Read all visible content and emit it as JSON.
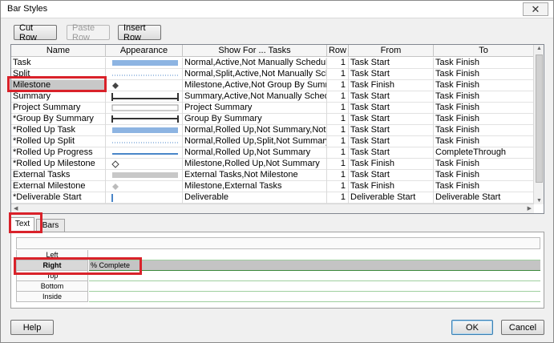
{
  "window": {
    "title": "Bar Styles",
    "close_glyph": "✕"
  },
  "toolbar": {
    "cut_row": "Cut Row",
    "paste_row": "Paste Row",
    "insert_row": "Insert Row"
  },
  "table": {
    "columns": [
      "Name",
      "Appearance",
      "Show For ... Tasks",
      "Row",
      "From",
      "To"
    ],
    "rows": [
      {
        "name": "Task",
        "appearance": "bar-blue",
        "show_for": "Normal,Active,Not Manually Scheduled",
        "row": "1",
        "from": "Task Start",
        "to": "Task Finish"
      },
      {
        "name": "Split",
        "appearance": "dotted-blue",
        "show_for": "Normal,Split,Active,Not Manually Schedu",
        "row": "1",
        "from": "Task Start",
        "to": "Task Finish"
      },
      {
        "name": "Milestone",
        "appearance": "diamond-dark",
        "show_for": "Milestone,Active,Not Group By Summary",
        "row": "1",
        "from": "Task Finish",
        "to": "Task Finish"
      },
      {
        "name": "Summary",
        "appearance": "summary-bracket",
        "show_for": "Summary,Active,Not Manually Scheduled",
        "row": "1",
        "from": "Task Start",
        "to": "Task Finish"
      },
      {
        "name": "Project Summary",
        "appearance": "project-summary",
        "show_for": "Project Summary",
        "row": "1",
        "from": "Task Start",
        "to": "Task Finish"
      },
      {
        "name": "*Group By Summary",
        "appearance": "group-bracket",
        "show_for": "Group By Summary",
        "row": "1",
        "from": "Task Start",
        "to": "Task Finish"
      },
      {
        "name": "*Rolled Up Task",
        "appearance": "bar-blue",
        "show_for": "Normal,Rolled Up,Not Summary,Not Ma",
        "row": "1",
        "from": "Task Start",
        "to": "Task Finish"
      },
      {
        "name": "*Rolled Up Split",
        "appearance": "dotted-blue",
        "show_for": "Normal,Rolled Up,Split,Not Summary",
        "row": "1",
        "from": "Task Start",
        "to": "Task Finish"
      },
      {
        "name": "*Rolled Up Progress",
        "appearance": "line-blue",
        "show_for": "Normal,Rolled Up,Not Summary",
        "row": "1",
        "from": "Task Start",
        "to": "CompleteThrough"
      },
      {
        "name": "*Rolled Up Milestone",
        "appearance": "diamond-outline",
        "show_for": "Milestone,Rolled Up,Not Summary",
        "row": "1",
        "from": "Task Finish",
        "to": "Task Finish"
      },
      {
        "name": "External Tasks",
        "appearance": "bar-gray",
        "show_for": "External Tasks,Not Milestone",
        "row": "1",
        "from": "Task Start",
        "to": "Task Finish"
      },
      {
        "name": "External Milestone",
        "appearance": "diamond-gray",
        "show_for": "Milestone,External Tasks",
        "row": "1",
        "from": "Task Finish",
        "to": "Task Finish"
      },
      {
        "name": "*Deliverable Start",
        "appearance": "tick-blue",
        "show_for": "Deliverable",
        "row": "1",
        "from": "Deliverable Start",
        "to": "Deliverable Start"
      }
    ]
  },
  "tabs": {
    "text": "Text",
    "bars": "Bars"
  },
  "text_panel": {
    "rows": [
      {
        "label": "Left",
        "value": ""
      },
      {
        "label": "Right",
        "value": "% Complete"
      },
      {
        "label": "Top",
        "value": ""
      },
      {
        "label": "Bottom",
        "value": ""
      },
      {
        "label": "Inside",
        "value": ""
      }
    ]
  },
  "footer": {
    "help": "Help",
    "ok": "OK",
    "cancel": "Cancel"
  },
  "colors": {
    "highlight": "#d9222a",
    "bar_blue": "#8db4e2",
    "line_blue": "#4a86c8",
    "bar_gray": "#c8c8c8"
  }
}
